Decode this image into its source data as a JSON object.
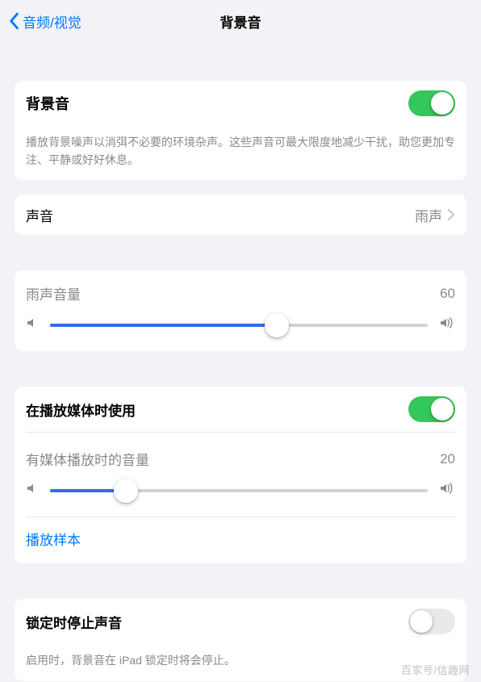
{
  "nav": {
    "back_label": "音频/视觉",
    "title": "背景音"
  },
  "main_toggle": {
    "label": "背景音",
    "description": "播放背景噪声以消弭不必要的环境杂声。这些声音可最大限度地减少干扰，助您更加专注、平静或好好休息。",
    "on": true
  },
  "sound_row": {
    "label": "声音",
    "value": "雨声"
  },
  "primary_volume": {
    "label": "雨声音量",
    "value": 60,
    "value_text": "60"
  },
  "media": {
    "use_label": "在播放媒体时使用",
    "use_on": true,
    "volume_label": "有媒体播放时的音量",
    "volume_value": 20,
    "volume_text": "20",
    "sample_label": "播放样本"
  },
  "lock": {
    "label": "锁定时停止声音",
    "on": false,
    "description": "启用时，背景音在 iPad 锁定时将会停止。"
  },
  "watermark": "百家号/信趣网"
}
